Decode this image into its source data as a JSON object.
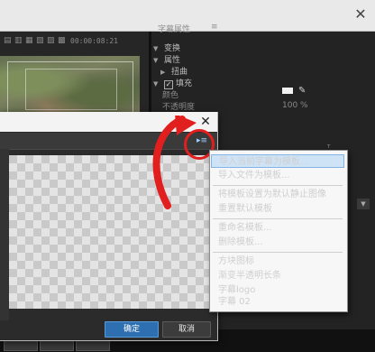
{
  "editor": {
    "timecode": "00:00:08:21",
    "tool_glyphs": [
      "▤",
      "▥",
      "▦",
      "▧",
      "▨",
      "▩"
    ],
    "close_glyph": "✕"
  },
  "title_properties": {
    "panel_title": "字幕属性",
    "panel_menu": "≡",
    "rows": [
      {
        "label": "变换",
        "tri": "▼"
      },
      {
        "label": "属性",
        "tri": "▼"
      },
      {
        "label": "扭曲",
        "tri": "▶"
      },
      {
        "label": "填充",
        "tri": "▼",
        "checked": true
      },
      {
        "label": "颜色"
      },
      {
        "label": "不透明度"
      }
    ],
    "check_glyph": "✓",
    "opacity_value": "100 %",
    "misc_text": "ᵀ",
    "fill_color": "#f2f2f2",
    "eyedropper_icon": "✎",
    "dropdown_glyph": "▼"
  },
  "dialog": {
    "close_glyph": "✕",
    "menu_glyph": "▸≡",
    "ok_label": "确定",
    "cancel_label": "取消"
  },
  "context_menu": {
    "items": [
      "导入当前字幕为模板...",
      "导入文件为模板...",
      "将模板设置为默认静止图像",
      "重置默认模板",
      "重命名模板...",
      "删除模板...",
      "方块图标",
      "渐变半透明长条",
      "字幕logo",
      "字幕 02"
    ],
    "highlighted_index": 0
  },
  "colors": {
    "annotation_red": "#e21f1f",
    "ok_blue": "#2d6fb0",
    "menu_highlight": "#cfe3f7"
  }
}
